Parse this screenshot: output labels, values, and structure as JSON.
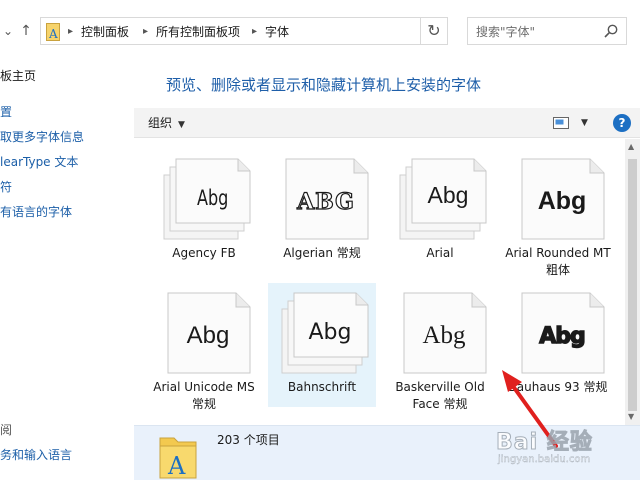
{
  "nav": {
    "breadcrumbs": [
      "控制面板",
      "所有控制面板项",
      "字体"
    ],
    "search_placeholder": "搜索\"字体\""
  },
  "left_pane": {
    "home_link": "板主页",
    "links": [
      "置",
      "取更多字体信息",
      "learType 文本",
      "符",
      "有语言的字体"
    ],
    "see_also_label": "阅",
    "bottom_link": "务和输入语言"
  },
  "main": {
    "heading": "预览、删除或者显示和隐藏计算机上安装的字体",
    "toolbar": {
      "organize_label": "组织"
    },
    "fonts": [
      {
        "name": "Agency FB",
        "sample": "Abg",
        "style": "stack",
        "selected": false
      },
      {
        "name": "Algerian 常规",
        "sample": "ABG",
        "style": "single",
        "selected": false
      },
      {
        "name": "Arial",
        "sample": "Abg",
        "style": "stack",
        "selected": false
      },
      {
        "name": "Arial Rounded MT 粗体",
        "sample": "Abg",
        "style": "single",
        "selected": false
      },
      {
        "name": "Arial Unicode MS 常规",
        "sample": "Abg",
        "style": "single",
        "selected": false
      },
      {
        "name": "Bahnschrift",
        "sample": "Abg",
        "style": "stack",
        "selected": true
      },
      {
        "name": "Baskerville Old Face 常规",
        "sample": "Abg",
        "style": "single",
        "selected": false
      },
      {
        "name": "Bauhaus 93 常规",
        "sample": "Abg",
        "style": "single",
        "selected": false
      }
    ]
  },
  "details": {
    "item_count": "203 个项目"
  },
  "watermark": {
    "text": "Bai 经验",
    "sub": "jingyan.baidu.com"
  },
  "colors": {
    "link": "#1c5fa8",
    "heading": "#1f5fa9",
    "selected": "#e5f3fb",
    "details_bg": "#e9f1fb",
    "arrow": "#e0201e"
  }
}
